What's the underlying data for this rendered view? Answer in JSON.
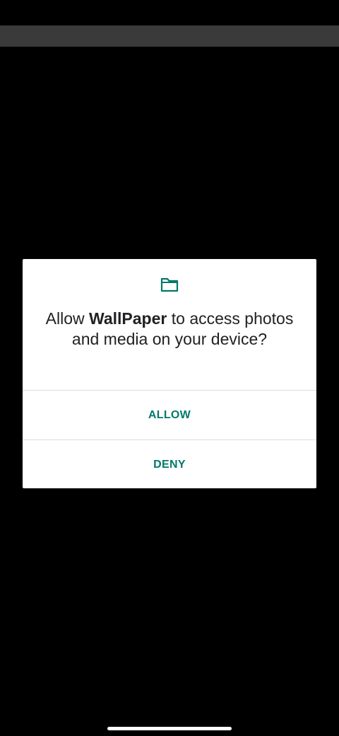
{
  "dialog": {
    "icon": "folder-icon",
    "message_prefix": "Allow ",
    "app_name": "WallPaper",
    "message_suffix": " to access photos and media on your device?",
    "allow_label": "ALLOW",
    "deny_label": "DENY"
  },
  "colors": {
    "accent": "#00796b",
    "background": "#000000",
    "dialog_background": "#ffffff",
    "status_strip": "#3a3a3a",
    "text": "#202124",
    "divider": "#dadce0"
  }
}
